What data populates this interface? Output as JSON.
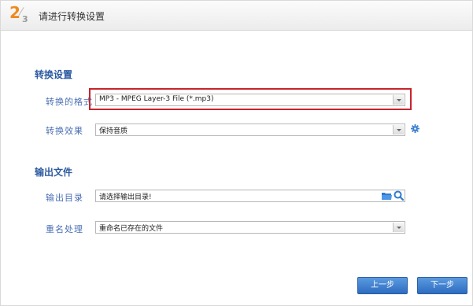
{
  "header": {
    "step_current": "2",
    "step_total": "3",
    "title": "请进行转换设置"
  },
  "conversion": {
    "section_title": "转换设置",
    "format_label": "转换的格式",
    "format_value": "MP3 - MPEG Layer-3 File (*.mp3)",
    "effect_label": "转换效果",
    "effect_value": "保持音质"
  },
  "output": {
    "section_title": "输出文件",
    "dir_label": "输出目录",
    "dir_value": "请选择输出目录!",
    "dup_label": "重名处理",
    "dup_value": "重命名已存在的文件"
  },
  "buttons": {
    "prev": "上一步",
    "next": "下一步"
  },
  "colors": {
    "accent": "#2c5aa0",
    "highlight": "#c9232b",
    "step": "#f08a1e"
  }
}
